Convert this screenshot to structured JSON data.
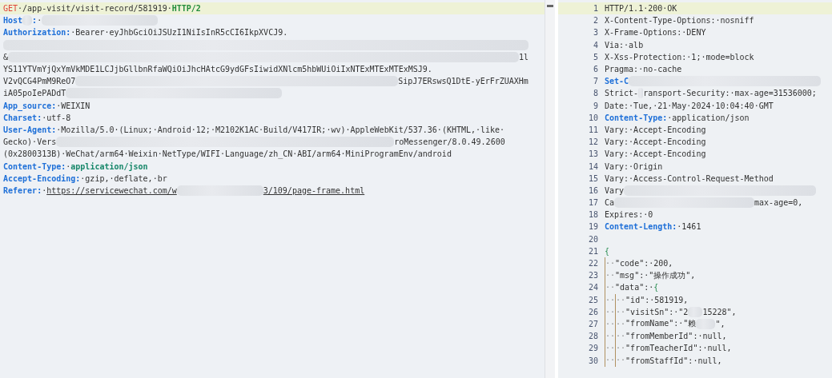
{
  "request": {
    "lines": [
      {
        "selected": true,
        "segments": [
          {
            "kind": "method",
            "text": "GET"
          },
          {
            "kind": "value",
            "text": "·/app-visit/visit-record/581919·"
          },
          {
            "kind": "version",
            "text": "HTTP/2"
          }
        ]
      },
      {
        "selected": false,
        "segments": [
          {
            "kind": "key",
            "text": "Host"
          },
          {
            "kind": "blur"
          },
          {
            "kind": "key",
            "text": ":"
          },
          {
            "kind": "value",
            "text": "·"
          },
          {
            "kind": "blur"
          }
        ]
      },
      {
        "selected": false,
        "segments": [
          {
            "kind": "key",
            "text": "Authorization:"
          },
          {
            "kind": "value",
            "text": "·Bearer·eyJhbGciOiJSUzI1NiIsInR5cCI6IkpXVCJ9."
          }
        ]
      },
      {
        "selected": false,
        "segments": [
          {
            "kind": "blur"
          }
        ]
      },
      {
        "selected": false,
        "segments": [
          {
            "kind": "value",
            "text": "&"
          },
          {
            "kind": "blur"
          },
          {
            "kind": "value",
            "text": "1l"
          }
        ]
      },
      {
        "selected": false,
        "segments": [
          {
            "kind": "value",
            "text": "YS11YTVmYjQxYmVkMDE1LCJjbGllbnRfaWQiOiJhcHAtcG9ydGFsIiwidXNlcm5hbWUiOiIxNTExMTExMTExMSJ9."
          }
        ]
      },
      {
        "selected": false,
        "segments": [
          {
            "kind": "value",
            "text": "V2vQCG4PmM9ReO7"
          },
          {
            "kind": "blur"
          },
          {
            "kind": "value",
            "text": "SipJ7ERswsQ1DtE-yErFrZUAXHm"
          }
        ]
      },
      {
        "selected": false,
        "segments": [
          {
            "kind": "value",
            "text": "iA05poIePADdT"
          },
          {
            "kind": "blur"
          }
        ]
      },
      {
        "selected": false,
        "segments": [
          {
            "kind": "key",
            "text": "App_source:"
          },
          {
            "kind": "value",
            "text": "·WEIXIN"
          }
        ]
      },
      {
        "selected": false,
        "segments": [
          {
            "kind": "key",
            "text": "Charset:"
          },
          {
            "kind": "value",
            "text": "·utf-8"
          }
        ]
      },
      {
        "selected": false,
        "segments": [
          {
            "kind": "key",
            "text": "User-Agent:"
          },
          {
            "kind": "value",
            "text": "·Mozilla/5.0·(Linux;·Android·12;·M2102K1AC·Build/V417IR;·wv)·AppleWebKit/537.36·(KHTML,·like·"
          }
        ]
      },
      {
        "selected": false,
        "segments": [
          {
            "kind": "value",
            "text": "Gecko)·Vers"
          },
          {
            "kind": "blur"
          },
          {
            "kind": "value",
            "text": "roMessenger/8.0.49.2600"
          }
        ]
      },
      {
        "selected": false,
        "segments": [
          {
            "kind": "value",
            "text": "(0x2800313B)·WeChat/arm64·Weixin·NetType/WIFI·Language/zh_CN·ABI/arm64·MiniProgramEnv/android"
          }
        ]
      },
      {
        "selected": false,
        "segments": [
          {
            "kind": "key",
            "text": "Content-Type:"
          },
          {
            "kind": "value",
            "text": "·"
          },
          {
            "kind": "green",
            "text": "application/json"
          }
        ]
      },
      {
        "selected": false,
        "segments": [
          {
            "kind": "key",
            "text": "Accept-Encoding:"
          },
          {
            "kind": "value",
            "text": "·gzip,·deflate,·br"
          }
        ]
      },
      {
        "selected": false,
        "segments": [
          {
            "kind": "key",
            "text": "Referer:"
          },
          {
            "kind": "value",
            "text": "·"
          },
          {
            "kind": "link",
            "text": "https://servicewechat.com/w"
          },
          {
            "kind": "blur"
          },
          {
            "kind": "link",
            "text": "3/109/page-frame.html"
          }
        ]
      }
    ]
  },
  "response": {
    "lines": [
      {
        "number": "1",
        "selected": true,
        "segments": [
          {
            "kind": "value",
            "text": "HTTP/1.1·200·OK"
          }
        ]
      },
      {
        "number": "2",
        "selected": false,
        "segments": [
          {
            "kind": "value",
            "text": "X-Content-Type-Options:·nosniff"
          }
        ]
      },
      {
        "number": "3",
        "selected": false,
        "segments": [
          {
            "kind": "value",
            "text": "X-Frame-Options:·DENY"
          }
        ]
      },
      {
        "number": "4",
        "selected": false,
        "segments": [
          {
            "kind": "value",
            "text": "Via:·alb"
          }
        ]
      },
      {
        "number": "5",
        "selected": false,
        "segments": [
          {
            "kind": "value",
            "text": "X-Xss-Protection:·1;·mode=block"
          }
        ]
      },
      {
        "number": "6",
        "selected": false,
        "segments": [
          {
            "kind": "value",
            "text": "Pragma:·no-cache"
          }
        ]
      },
      {
        "number": "7",
        "selected": false,
        "segments": [
          {
            "kind": "key",
            "text": "Set-C"
          },
          {
            "kind": "blur"
          }
        ]
      },
      {
        "number": "8",
        "selected": false,
        "segments": [
          {
            "kind": "value",
            "text": "Strict-"
          },
          {
            "kind": "blur"
          },
          {
            "kind": "value",
            "text": "ransport-Security:·max-age=31536000;"
          }
        ]
      },
      {
        "number": "9",
        "selected": false,
        "segments": [
          {
            "kind": "value",
            "text": "Date:·Tue,·21·May·2024·10:04:40·GMT"
          }
        ]
      },
      {
        "number": "10",
        "selected": false,
        "segments": [
          {
            "kind": "key",
            "text": "Content-Type:"
          },
          {
            "kind": "value",
            "text": "·application/json"
          }
        ]
      },
      {
        "number": "11",
        "selected": false,
        "segments": [
          {
            "kind": "value",
            "text": "Vary:·Accept-Encoding"
          }
        ]
      },
      {
        "number": "12",
        "selected": false,
        "segments": [
          {
            "kind": "value",
            "text": "Vary:·Accept-Encoding"
          }
        ]
      },
      {
        "number": "13",
        "selected": false,
        "segments": [
          {
            "kind": "value",
            "text": "Vary:·Accept-Encoding"
          }
        ]
      },
      {
        "number": "14",
        "selected": false,
        "segments": [
          {
            "kind": "value",
            "text": "Vary:·Origin"
          }
        ]
      },
      {
        "number": "15",
        "selected": false,
        "segments": [
          {
            "kind": "value",
            "text": "Vary:·Access-Control-Request-Method"
          }
        ]
      },
      {
        "number": "16",
        "selected": false,
        "segments": [
          {
            "kind": "value",
            "text": "Vary"
          },
          {
            "kind": "blur"
          }
        ]
      },
      {
        "number": "17",
        "selected": false,
        "segments": [
          {
            "kind": "value",
            "text": "Ca"
          },
          {
            "kind": "blur"
          },
          {
            "kind": "value",
            "text": "max-age=0,"
          }
        ]
      },
      {
        "number": "18",
        "selected": false,
        "segments": [
          {
            "kind": "value",
            "text": "Expires:·0"
          }
        ]
      },
      {
        "number": "19",
        "selected": false,
        "segments": [
          {
            "kind": "key",
            "text": "Content-Length:"
          },
          {
            "kind": "value",
            "text": "·1461"
          }
        ]
      },
      {
        "number": "20",
        "selected": false
      },
      {
        "number": "21",
        "selected": false,
        "segments": [
          {
            "kind": "brace",
            "text": "{"
          }
        ]
      },
      {
        "number": "22",
        "selected": false,
        "segments": [
          {
            "kind": "guide",
            "text": "··"
          },
          {
            "kind": "value",
            "text": "\"code\":·200,"
          }
        ]
      },
      {
        "number": "23",
        "selected": false,
        "segments": [
          {
            "kind": "guide",
            "text": "··"
          },
          {
            "kind": "value",
            "text": "\"msg\":·\"操作成功\","
          }
        ]
      },
      {
        "number": "24",
        "selected": false,
        "segments": [
          {
            "kind": "guide",
            "text": "··"
          },
          {
            "kind": "value",
            "text": "\"data\":·"
          },
          {
            "kind": "brace",
            "text": "{"
          }
        ]
      },
      {
        "number": "25",
        "selected": false,
        "segments": [
          {
            "kind": "guide",
            "text": "··"
          },
          {
            "kind": "guide",
            "text": "··"
          },
          {
            "kind": "value",
            "text": "\"id\":·581919,"
          }
        ]
      },
      {
        "number": "26",
        "selected": false,
        "segments": [
          {
            "kind": "guide",
            "text": "··"
          },
          {
            "kind": "guide",
            "text": "··"
          },
          {
            "kind": "value",
            "text": "\"visitSn\":·\"2"
          },
          {
            "kind": "blur"
          },
          {
            "kind": "value",
            "text": "15228\","
          }
        ]
      },
      {
        "number": "27",
        "selected": false,
        "segments": [
          {
            "kind": "guide",
            "text": "··"
          },
          {
            "kind": "guide",
            "text": "··"
          },
          {
            "kind": "value",
            "text": "\"fromName\":·\"赖"
          },
          {
            "kind": "blur"
          },
          {
            "kind": "value",
            "text": "\","
          }
        ]
      },
      {
        "number": "28",
        "selected": false,
        "segments": [
          {
            "kind": "guide",
            "text": "··"
          },
          {
            "kind": "guide",
            "text": "··"
          },
          {
            "kind": "value",
            "text": "\"fromMemberId\":·null,"
          }
        ]
      },
      {
        "number": "29",
        "selected": false,
        "segments": [
          {
            "kind": "guide",
            "text": "··"
          },
          {
            "kind": "guide",
            "text": "··"
          },
          {
            "kind": "value",
            "text": "\"fromTeacherId\":·null,"
          }
        ]
      },
      {
        "number": "30",
        "selected": false,
        "segments": [
          {
            "kind": "guide",
            "text": "··"
          },
          {
            "kind": "guide",
            "text": "··"
          },
          {
            "kind": "value",
            "text": "\"fromStaffId\":·null,"
          }
        ]
      }
    ]
  }
}
